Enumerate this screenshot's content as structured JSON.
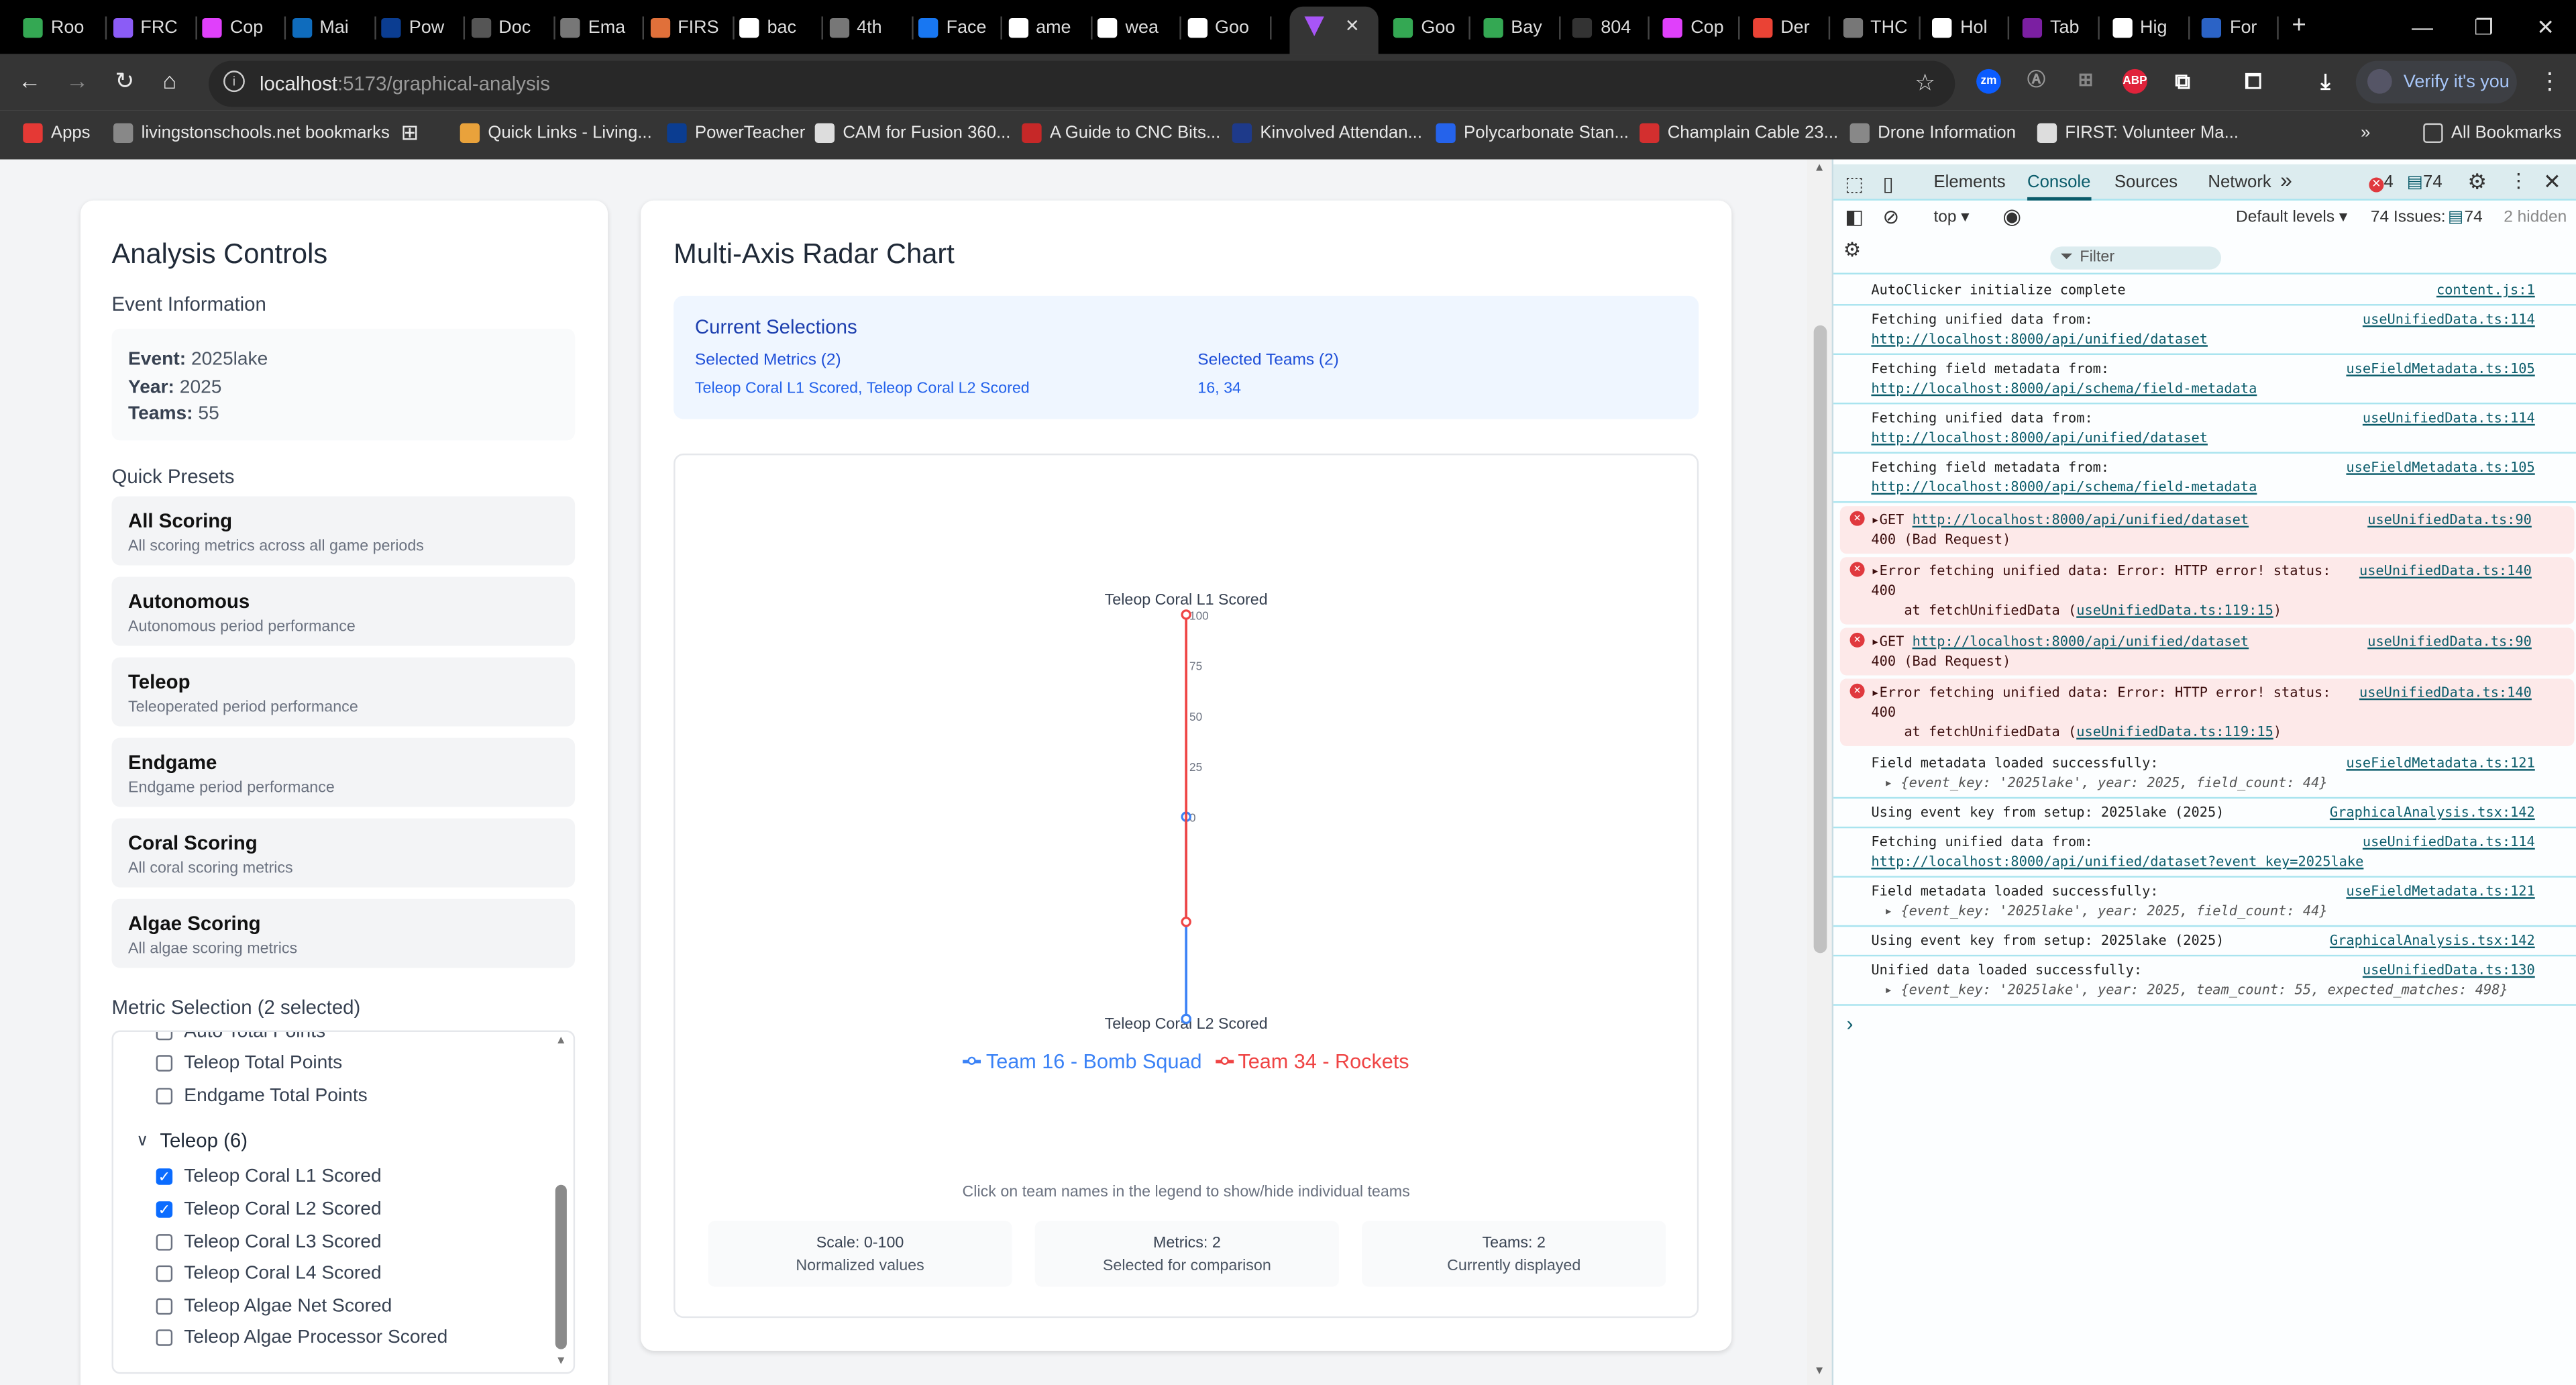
{
  "browser": {
    "tabs": [
      {
        "label": "Roo",
        "color": "#34a853"
      },
      {
        "label": "FRC",
        "color": "#8b5cf6"
      },
      {
        "label": "Cop",
        "color": "#e040fb"
      },
      {
        "label": "Mai",
        "color": "#0f6cbd"
      },
      {
        "label": "Pow",
        "color": "#0b3d91"
      },
      {
        "label": "Doc",
        "color": "#555"
      },
      {
        "label": "Ema",
        "color": "#777"
      },
      {
        "label": "FIRS",
        "color": "#e0703a"
      },
      {
        "label": "bac",
        "color": "#fff"
      },
      {
        "label": "4th",
        "color": "#777"
      },
      {
        "label": "Face",
        "color": "#1877f2"
      },
      {
        "label": "ame",
        "color": "#fff"
      },
      {
        "label": "wea",
        "color": "#fff"
      },
      {
        "label": "Goo",
        "color": "#fff"
      }
    ],
    "active_tab": {
      "close": "×",
      "color": "#a855f7"
    },
    "tabs_after": [
      {
        "label": "Goo",
        "color": "#34a853"
      },
      {
        "label": "Bay",
        "color": "#34a853"
      },
      {
        "label": "804",
        "color": "#333"
      },
      {
        "label": "Cop",
        "color": "#e040fb"
      },
      {
        "label": "Der",
        "color": "#ea4335"
      },
      {
        "label": "THC",
        "color": "#777"
      },
      {
        "label": "Hol",
        "color": "#fff"
      },
      {
        "label": "Tab",
        "color": "#7b1fa2"
      },
      {
        "label": "Hig",
        "color": "#fff"
      },
      {
        "label": "For",
        "color": "#2b63c6"
      }
    ],
    "new_tab": "+",
    "url_host": "localhost",
    "url_path": ":5173/graphical-analysis",
    "verify": "Verify it's you",
    "bookmarks": [
      {
        "label": "Apps"
      },
      {
        "label": "livingstonschools.net bookmarks"
      },
      {
        "label": "Quick Links - Living..."
      },
      {
        "label": "PowerTeacher"
      },
      {
        "label": "CAM for Fusion 360..."
      },
      {
        "label": "A Guide to CNC Bits..."
      },
      {
        "label": "Kinvolved Attendan..."
      },
      {
        "label": "Polycarbonate Stan..."
      },
      {
        "label": "Champlain Cable 23..."
      },
      {
        "label": "Drone Information"
      },
      {
        "label": "FIRST: Volunteer Ma..."
      }
    ],
    "all_bookmarks": "All Bookmarks"
  },
  "controls": {
    "title": "Analysis Controls",
    "event_info_label": "Event Information",
    "event_label": "Event:",
    "event": "2025lake",
    "year_label": "Year:",
    "year": "2025",
    "teams_label": "Teams:",
    "teams": "55",
    "presets_label": "Quick Presets",
    "presets": [
      {
        "title": "All Scoring",
        "desc": "All scoring metrics across all game periods"
      },
      {
        "title": "Autonomous",
        "desc": "Autonomous period performance"
      },
      {
        "title": "Teleop",
        "desc": "Teleoperated period performance"
      },
      {
        "title": "Endgame",
        "desc": "Endgame period performance"
      },
      {
        "title": "Coral Scoring",
        "desc": "All coral scoring metrics"
      },
      {
        "title": "Algae Scoring",
        "desc": "All algae scoring metrics"
      }
    ],
    "metric_selection_label": "Metric Selection (2 selected)",
    "metrics_above": [
      {
        "label": "Auto Total Points",
        "checked": false
      },
      {
        "label": "Teleop Total Points",
        "checked": false
      },
      {
        "label": "Endgame Total Points",
        "checked": false
      }
    ],
    "group_label": "Teleop (6)",
    "metrics": [
      {
        "label": "Teleop Coral L1 Scored",
        "checked": true
      },
      {
        "label": "Teleop Coral L2 Scored",
        "checked": true
      },
      {
        "label": "Teleop Coral L3 Scored",
        "checked": false
      },
      {
        "label": "Teleop Coral L4 Scored",
        "checked": false
      },
      {
        "label": "Teleop Algae Net Scored",
        "checked": false
      },
      {
        "label": "Teleop Algae Processor Scored",
        "checked": false
      }
    ]
  },
  "main": {
    "title": "Multi-Axis Radar Chart",
    "current_selections": "Current Selections",
    "selected_metrics_label": "Selected Metrics (2)",
    "selected_metrics": "Teleop Coral L1 Scored, Teleop Coral L2 Scored",
    "selected_teams_label": "Selected Teams (2)",
    "selected_teams": "16, 34",
    "hint": "Click on team names in the legend to show/hide individual teams",
    "stats": [
      {
        "a": "Scale: 0-100",
        "b": "Normalized values"
      },
      {
        "a": "Metrics: 2",
        "b": "Selected for comparison"
      },
      {
        "a": "Teams: 2",
        "b": "Currently displayed"
      }
    ]
  },
  "chart_data": {
    "type": "radar",
    "axes": [
      "Teleop Coral L1 Scored",
      "Teleop Coral L2 Scored"
    ],
    "range": [
      0,
      100
    ],
    "ticks": [
      "100",
      "75",
      "50",
      "25",
      "0"
    ],
    "series": [
      {
        "name": "Team 16 - Bomb Squad",
        "color": "#3b82f6",
        "values": [
          0,
          100
        ]
      },
      {
        "name": "Team 34 - Rockets",
        "color": "#ef4444",
        "values": [
          100,
          52
        ]
      }
    ],
    "legend": "bottom"
  },
  "devtools": {
    "tabs": [
      "Elements",
      "Console",
      "Sources",
      "Network"
    ],
    "more": "»",
    "errors": "4",
    "issues_badge": "74",
    "context": "top ▾",
    "filter": "Filter",
    "levels": "Default levels ▾",
    "issues": "74 Issues:",
    "issues_count": "74",
    "hidden": "2 hidden",
    "logs": [
      {
        "type": "log",
        "text": "AutoClicker initialize complete",
        "src": "content.js:1"
      },
      {
        "type": "log",
        "text": "Fetching unified data from:",
        "link": "http://localhost:8000/api/unified/dataset",
        "src": "useUnifiedData.ts:114"
      },
      {
        "type": "log",
        "text": "Fetching field metadata from:",
        "link": "http://localhost:8000/api/schema/field-metadata",
        "src": "useFieldMetadata.ts:105"
      },
      {
        "type": "log",
        "text": "Fetching unified data from:",
        "link": "http://localhost:8000/api/unified/dataset",
        "src": "useUnifiedData.ts:114"
      },
      {
        "type": "log",
        "text": "Fetching field metadata from:",
        "link": "http://localhost:8000/api/schema/field-metadata",
        "src": "useFieldMetadata.ts:105"
      },
      {
        "type": "get",
        "text": "▸GET ",
        "link": "http://localhost:8000/api/unified/dataset",
        "line2": "400 (Bad Request)",
        "src": "useUnifiedData.ts:90"
      },
      {
        "type": "err",
        "text": "▸Error fetching unified data: Error: HTTP error! status: 400",
        "line2": "    at fetchUnifiedData (",
        "link": "useUnifiedData.ts:119:15",
        "tail": ")",
        "src": "useUnifiedData.ts:140"
      },
      {
        "type": "get",
        "text": "▸GET ",
        "link": "http://localhost:8000/api/unified/dataset",
        "line2": "400 (Bad Request)",
        "src": "useUnifiedData.ts:90"
      },
      {
        "type": "err",
        "text": "▸Error fetching unified data: Error: HTTP error! status: 400",
        "line2": "    at fetchUnifiedData (",
        "link": "useUnifiedData.ts:119:15",
        "tail": ")",
        "src": "useUnifiedData.ts:140"
      },
      {
        "type": "obj",
        "text": "Field metadata loaded successfully:",
        "obj": "▸ {event_key: '2025lake', year: 2025, field_count: 44}",
        "src": "useFieldMetadata.ts:121"
      },
      {
        "type": "log",
        "text": "Using event key from setup: 2025lake (2025)",
        "src": "GraphicalAnalysis.tsx:142"
      },
      {
        "type": "log",
        "text": "Fetching unified data from:",
        "link": "http://localhost:8000/api/unified/dataset?event_key=2025lake",
        "src": "useUnifiedData.ts:114"
      },
      {
        "type": "obj",
        "text": "Field metadata loaded successfully:",
        "obj": "▸ {event_key: '2025lake', year: 2025, field_count: 44}",
        "src": "useFieldMetadata.ts:121"
      },
      {
        "type": "log",
        "text": "Using event key from setup: 2025lake (2025)",
        "src": "GraphicalAnalysis.tsx:142"
      },
      {
        "type": "obj",
        "text": "Unified data loaded successfully:",
        "obj": "▸ {event_key: '2025lake', year: 2025, team_count: 55, expected_matches: 498}",
        "src": "useUnifiedData.ts:130"
      }
    ],
    "prompt": "›"
  }
}
